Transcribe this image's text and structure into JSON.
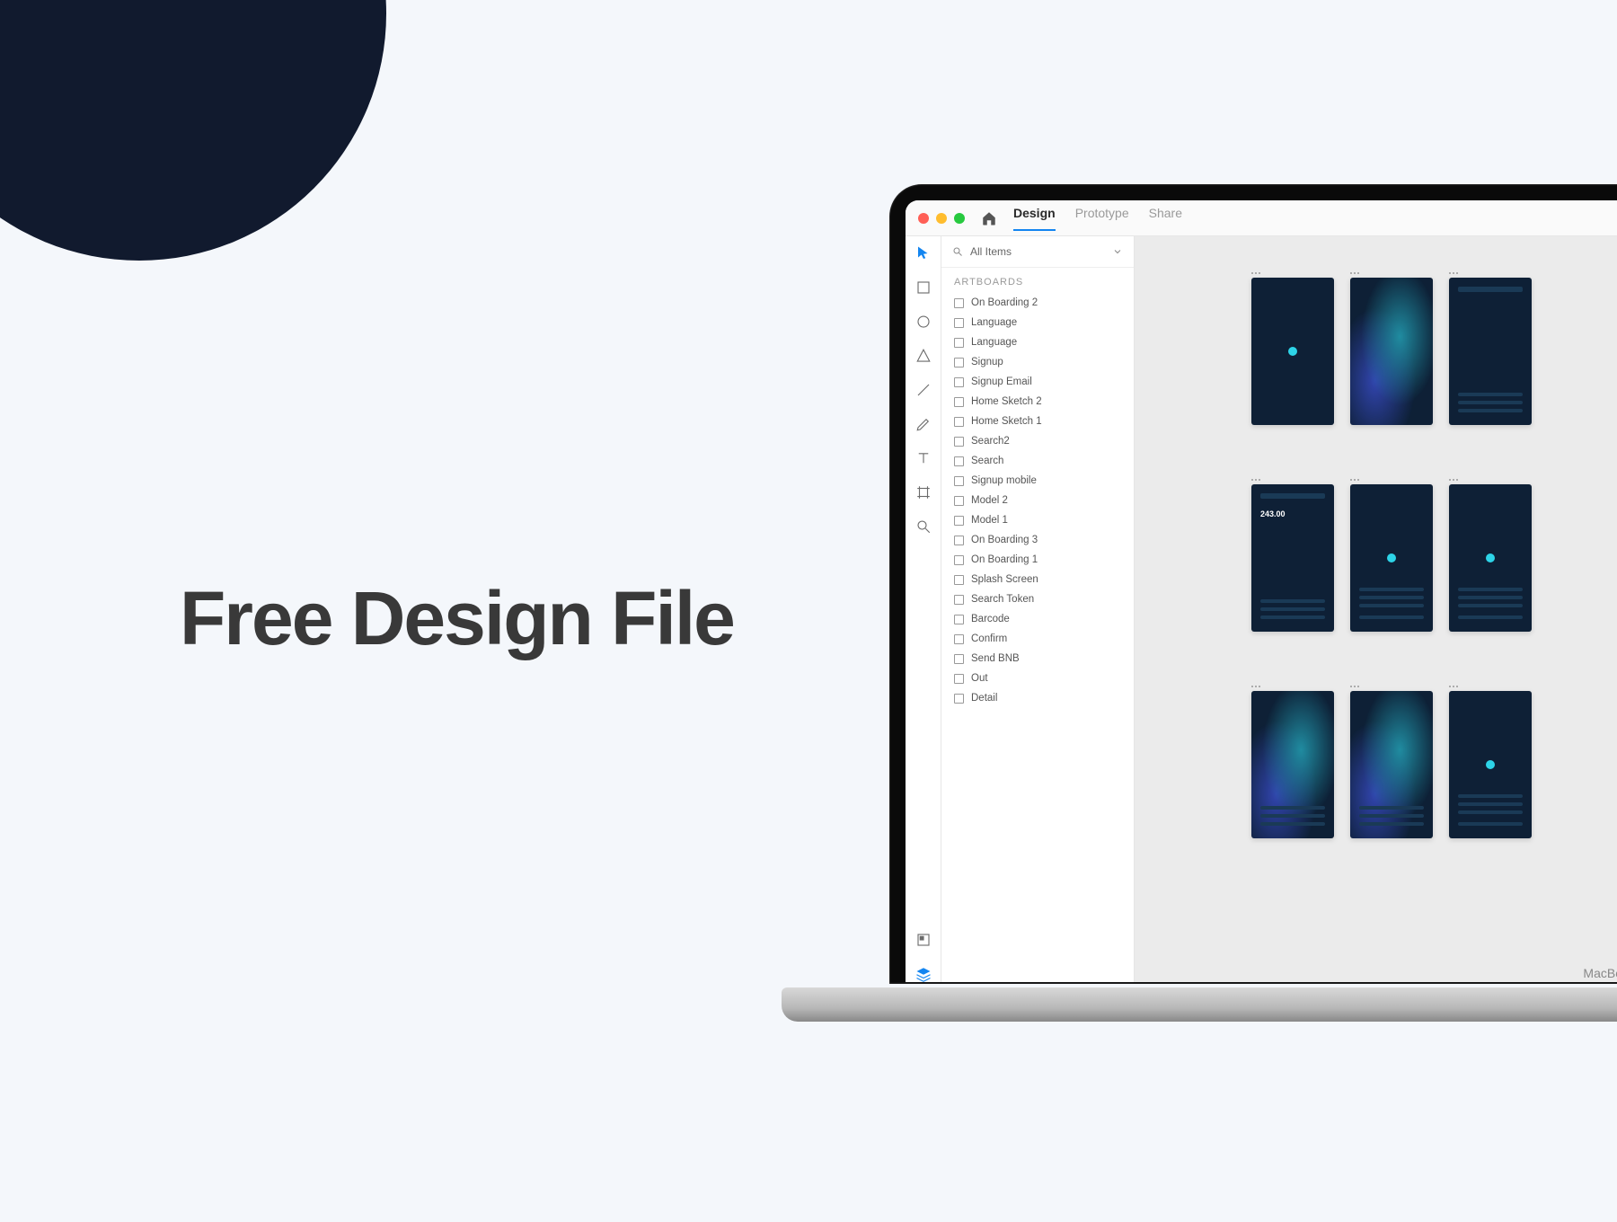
{
  "headline": "Free Design File",
  "laptop_label": "MacBo",
  "titlebar": {
    "tabs": [
      "Design",
      "Prototype",
      "Share"
    ],
    "active_tab": 0
  },
  "panel": {
    "search_label": "All Items",
    "section_title": "ARTBOARDS",
    "artboards": [
      "On Boarding 2",
      "Language",
      "Language",
      "Signup",
      "Signup Email",
      "Home Sketch 2",
      "Home Sketch 1",
      "Search2",
      "Search",
      "Signup mobile",
      "Model 2",
      "Model 1",
      "On Boarding 3",
      "On Boarding 1",
      "Splash Screen",
      "Search Token",
      "Barcode",
      "Confirm",
      "Send BNB",
      "Out",
      "Detail"
    ]
  },
  "canvas": {
    "sample_value": "243.00"
  }
}
